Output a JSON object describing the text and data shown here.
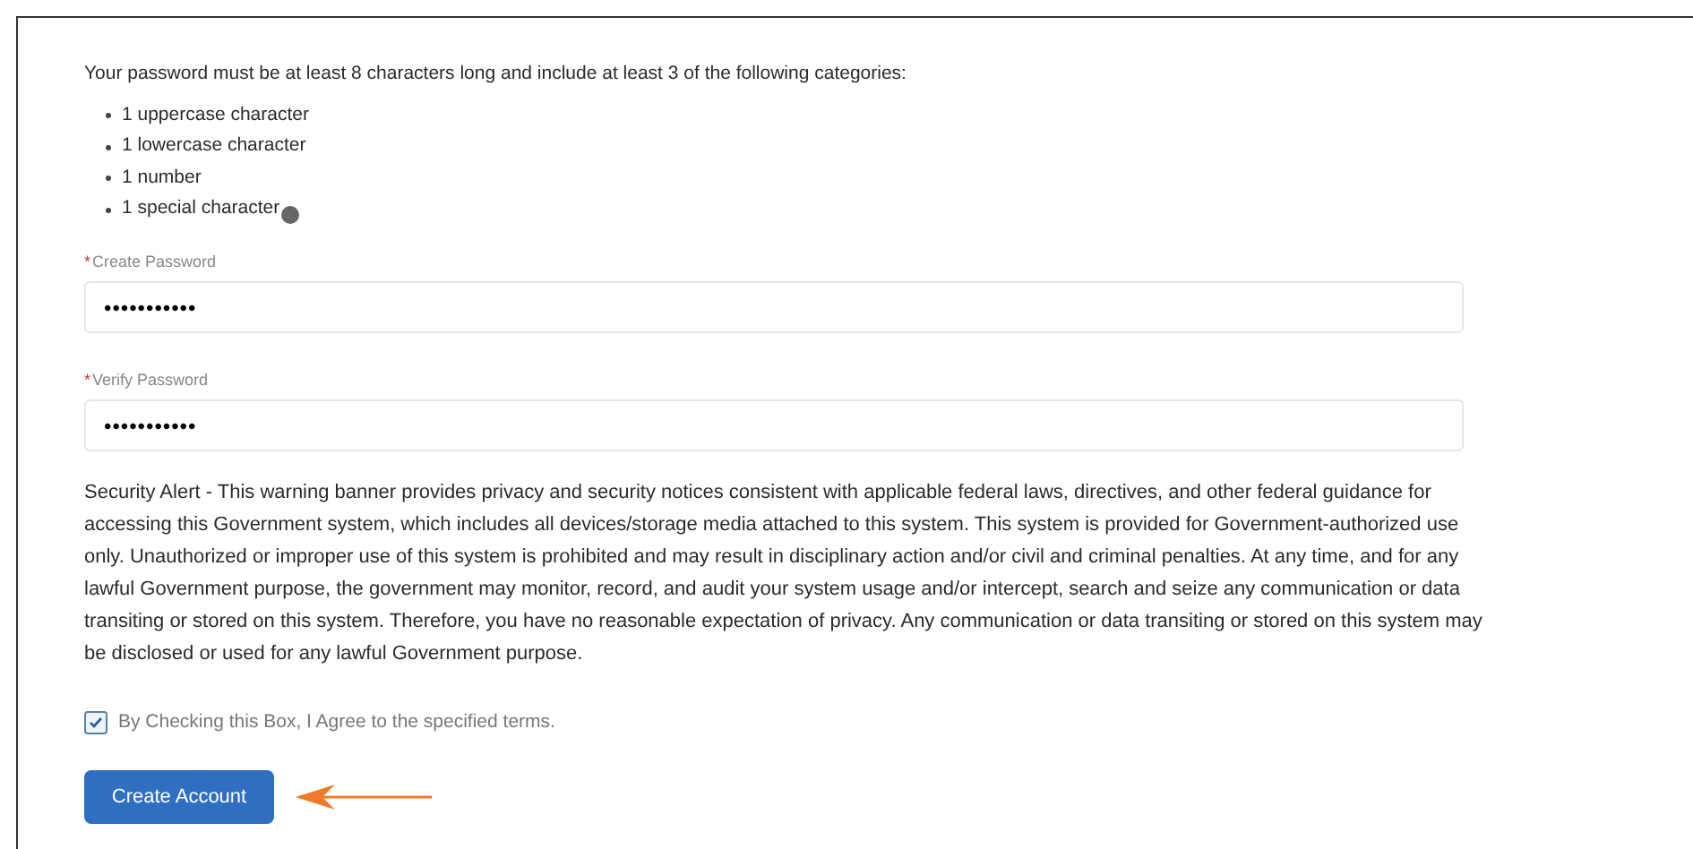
{
  "requirements": {
    "intro": "Your password must be at least 8 characters long and include at least 3 of the following categories:",
    "items": [
      {
        "text": "1 uppercase character",
        "info": false
      },
      {
        "text": "1 lowercase character",
        "info": false
      },
      {
        "text": "1 number",
        "info": false
      },
      {
        "text": "1 special character",
        "info": true
      }
    ]
  },
  "fields": [
    {
      "label": "Create Password",
      "required_mark": "*",
      "value": "•••••••••••"
    },
    {
      "label": "Verify Password",
      "required_mark": "*",
      "value": "•••••••••••"
    }
  ],
  "security_alert": "Security Alert - This warning banner provides privacy and security notices consistent with applicable federal laws, directives, and other federal guidance for accessing this Government system, which includes all devices/storage media attached to this system. This system is provided for Government-authorized use only. Unauthorized or improper use of this system is prohibited and may result in disciplinary action and/or civil and criminal penalties. At any time, and for any lawful Government purpose, the government may monitor, record, and audit your system usage and/or intercept, search and seize any communication or data transiting or stored on this system. Therefore, you have no reasonable expectation of privacy. Any communication or data transiting or stored on this system may be disclosed or used for any lawful Government purpose.",
  "agreement": {
    "label": "By Checking this Box, I Agree to the specified terms.",
    "checked": true
  },
  "submit_button": {
    "label": "Create Account"
  }
}
